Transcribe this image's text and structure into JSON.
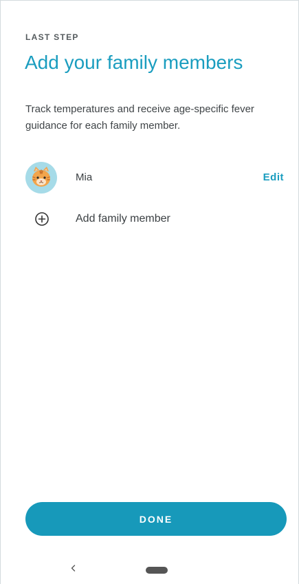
{
  "onboarding": {
    "step_label": "LAST STEP",
    "title": "Add your family members",
    "subtitle": "Track temperatures and receive age-specific fever guidance for each family member."
  },
  "members": [
    {
      "name": "Mia",
      "avatar_icon": "tiger-cat-avatar-icon",
      "action_label": "Edit"
    }
  ],
  "add_member": {
    "icon": "plus-circle-icon",
    "label": "Add family member"
  },
  "footer": {
    "done_label": "DONE"
  },
  "system_nav": {
    "back_icon": "chevron-left-icon",
    "home_icon": "home-pill-icon"
  },
  "colors": {
    "accent": "#1a9dbf",
    "button": "#1799ba",
    "avatar_bg": "#a6dbe8",
    "text": "#3a3f42"
  }
}
